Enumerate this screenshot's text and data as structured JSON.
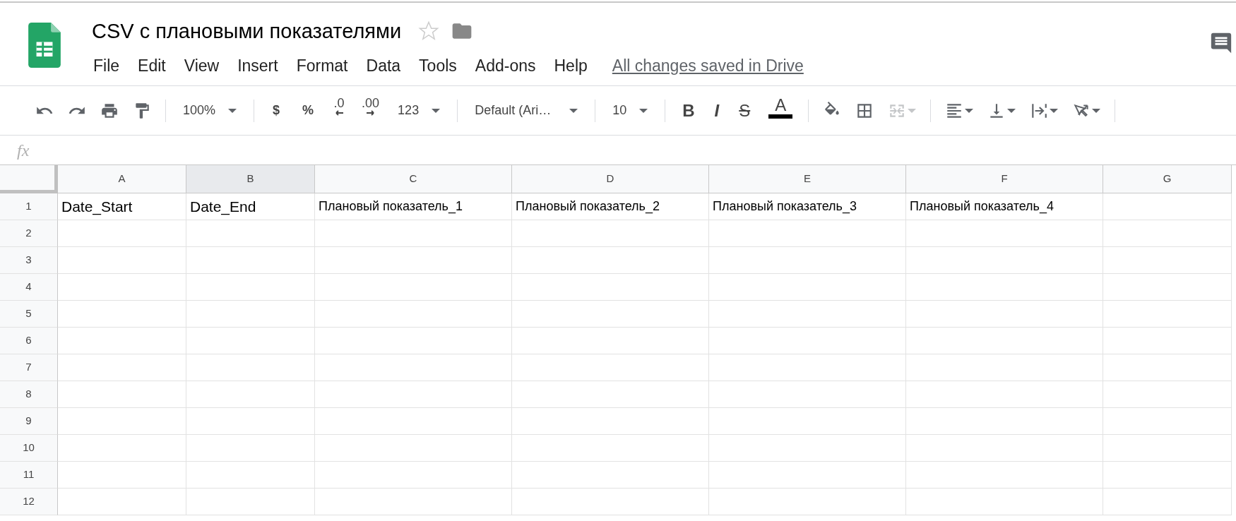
{
  "document": {
    "title": "CSV с плановыми показателями",
    "starred": false
  },
  "menu": [
    {
      "label": "File"
    },
    {
      "label": "Edit"
    },
    {
      "label": "View"
    },
    {
      "label": "Insert"
    },
    {
      "label": "Format"
    },
    {
      "label": "Data"
    },
    {
      "label": "Tools"
    },
    {
      "label": "Add-ons"
    },
    {
      "label": "Help"
    }
  ],
  "save_status": "All changes saved in Drive",
  "toolbar": [
    [
      {
        "kind": "icon",
        "disabled": false
      },
      {
        "kind": "icon",
        "disabled": false
      },
      {
        "kind": "icon",
        "disabled": false
      },
      {
        "kind": "icon",
        "disabled": false
      }
    ],
    [
      {
        "kind": "dropdown",
        "text": "100%",
        "disabled": false
      }
    ],
    [
      {
        "kind": "text",
        "text": "$",
        "disabled": false
      },
      {
        "kind": "text",
        "text": "%",
        "disabled": false
      },
      {
        "kind": "decimal_less",
        "text": ".0",
        "disabled": false
      },
      {
        "kind": "decimal_more",
        "text": ".00",
        "disabled": false
      },
      {
        "kind": "dropdown",
        "text": "123",
        "disabled": false
      }
    ],
    [
      {
        "kind": "dropdown",
        "text": "Default (Ari…",
        "disabled": false
      }
    ],
    [
      {
        "kind": "dropdown",
        "text": "10",
        "disabled": false
      }
    ],
    [
      {
        "kind": "bold",
        "text": "B",
        "disabled": false
      },
      {
        "kind": "italic",
        "text": "I",
        "disabled": false
      },
      {
        "kind": "strike",
        "text": "S",
        "disabled": false
      },
      {
        "kind": "text_color",
        "text": "A",
        "color": "#000000",
        "disabled": false
      }
    ],
    [
      {
        "kind": "icon",
        "disabled": false
      },
      {
        "kind": "icon",
        "disabled": false
      },
      {
        "kind": "icon_dropdown",
        "disabled": true
      }
    ],
    [
      {
        "kind": "icon_dropdown",
        "disabled": false
      },
      {
        "kind": "icon_dropdown",
        "disabled": false
      },
      {
        "kind": "icon_dropdown",
        "disabled": false
      },
      {
        "kind": "icon_dropdown",
        "disabled": false
      }
    ]
  ],
  "formula_bar": {
    "label": "fx"
  },
  "columns": [
    {
      "label": "A",
      "selected": false
    },
    {
      "label": "B",
      "selected": true
    },
    {
      "label": "C",
      "selected": false
    },
    {
      "label": "D",
      "selected": false
    },
    {
      "label": "E",
      "selected": false
    },
    {
      "label": "F",
      "selected": false
    },
    {
      "label": "G",
      "selected": false
    }
  ],
  "rows": [
    {
      "label": "1",
      "cells": [
        {
          "text": "Date_Start",
          "kind": "large"
        },
        {
          "text": "Date_End",
          "kind": "large"
        },
        {
          "text": "Плановый показатель_1",
          "kind": "normal"
        },
        {
          "text": "Плановый показатель_2",
          "kind": "normal"
        },
        {
          "text": "Плановый показатель_3",
          "kind": "normal"
        },
        {
          "text": "Плановый показатель_4",
          "kind": "normal"
        }
      ]
    },
    {
      "label": "2"
    },
    {
      "label": "3"
    },
    {
      "label": "4"
    },
    {
      "label": "5"
    },
    {
      "label": "6"
    },
    {
      "label": "7"
    },
    {
      "label": "8"
    },
    {
      "label": "9"
    },
    {
      "label": "10"
    },
    {
      "label": "11"
    },
    {
      "label": "12"
    }
  ]
}
